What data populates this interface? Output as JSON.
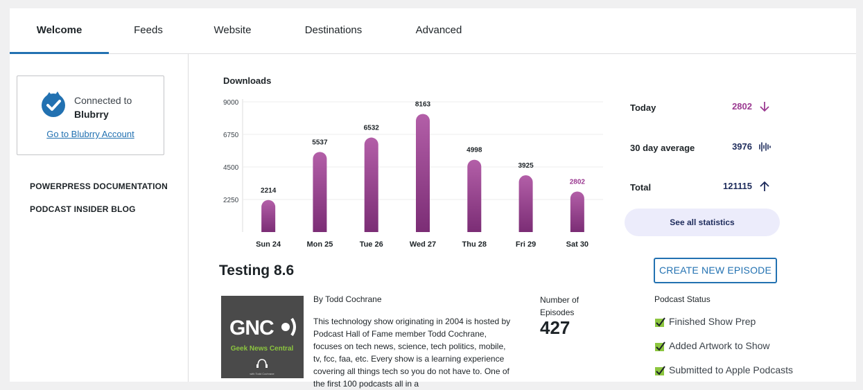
{
  "tabs": [
    {
      "label": "Welcome",
      "active": true
    },
    {
      "label": "Feeds"
    },
    {
      "label": "Website"
    },
    {
      "label": "Destinations"
    },
    {
      "label": "Advanced"
    }
  ],
  "sidebar": {
    "connected_prefix": "Connected to",
    "connected_service": "Blubrry",
    "account_link": "Go to Blubrry Account",
    "links": [
      "POWERPRESS DOCUMENTATION",
      "PODCAST INSIDER BLOG"
    ]
  },
  "downloads": {
    "title": "Downloads",
    "chart_data": {
      "type": "bar",
      "title": "Downloads",
      "categories": [
        "Sun 24",
        "Mon 25",
        "Tue 26",
        "Wed 27",
        "Thu 28",
        "Fri 29",
        "Sat 30"
      ],
      "values": [
        2214,
        5537,
        6532,
        8163,
        4998,
        3925,
        2802
      ],
      "y_ticks": [
        "9000",
        "6750",
        "4500",
        "2250"
      ],
      "ylim": [
        0,
        9000
      ],
      "grid": true,
      "highlight_last": true,
      "colors": {
        "bar_top": "#b35fa8",
        "bar_bottom": "#7b2d75",
        "highlight_label": "#9b3a91"
      }
    }
  },
  "stats": {
    "today": {
      "label": "Today",
      "value": "2802",
      "icon": "arrow-down-icon",
      "color": "#9b3a91"
    },
    "avg": {
      "label": "30 day average",
      "value": "3976",
      "icon": "audio-wave-icon",
      "color": "#1d2b5b"
    },
    "total": {
      "label": "Total",
      "value": "121115",
      "icon": "arrow-up-icon",
      "color": "#1d2b5b"
    },
    "see_all": "See all statistics"
  },
  "show": {
    "title": "Testing 8.6",
    "author": "By Todd Cochrane",
    "description": "This technology show originating in 2004 is hosted by Podcast Hall of Fame member Todd Cochrane, focuses on tech news, science, tech politics, mobile, tv, fcc, faa, etc. Every show is a learning experience covering all things tech so you do not have to. One of the first 100 podcasts all in a",
    "artwork": {
      "logo": "GNC",
      "tagline": "Geek News Central",
      "byline": "with Todd Cochrane"
    },
    "episodes_label": "Number of Episodes",
    "episodes_count": "427"
  },
  "actions": {
    "create_episode": "CREATE NEW EPISODE"
  },
  "podcast_status": {
    "label": "Podcast Status",
    "items": [
      "Finished Show Prep",
      "Added Artwork to Show",
      "Submitted to Apple Podcasts"
    ],
    "check_color": "#8cc63f"
  }
}
